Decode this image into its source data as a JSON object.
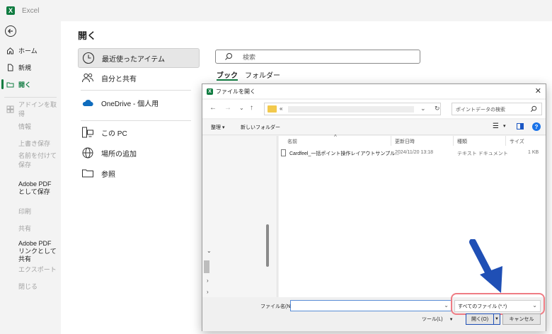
{
  "app": {
    "logo": "X",
    "title": "Excel"
  },
  "sidebar": {
    "items": [
      {
        "label": "ホーム",
        "icon": "home-icon"
      },
      {
        "label": "新規",
        "icon": "new-file-icon"
      },
      {
        "label": "開く",
        "icon": "open-folder-icon",
        "active": true
      },
      {
        "label": "アドインを取得",
        "icon": "grid-icon",
        "disabled": true
      },
      {
        "label": "情報",
        "disabled": true
      },
      {
        "label": "上書き保存",
        "disabled": true
      },
      {
        "label": "名前を付けて保存",
        "disabled": true
      },
      {
        "label": "Adobe PDF として保存"
      },
      {
        "label": "印刷",
        "disabled": true
      },
      {
        "label": "共有",
        "disabled": true
      },
      {
        "label": "Adobe PDF リンクとして共有"
      },
      {
        "label": "エクスポート",
        "disabled": true
      },
      {
        "label": "閉じる",
        "disabled": true
      }
    ]
  },
  "main": {
    "title": "開く",
    "locations": [
      {
        "label": "最近使ったアイテム",
        "icon": "clock-icon"
      },
      {
        "label": "自分と共有",
        "icon": "people-icon"
      },
      {
        "label": "OneDrive - 個人用",
        "icon": "cloud-icon"
      },
      {
        "label": "この PC",
        "icon": "pc-icon"
      },
      {
        "label": "場所の追加",
        "icon": "globe-icon"
      },
      {
        "label": "参照",
        "icon": "folder-icon"
      }
    ],
    "search_placeholder": "検索",
    "tabs": [
      "ブック",
      "フォルダー"
    ]
  },
  "dialog": {
    "title": "ファイルを開く",
    "breadcrumb": "«",
    "search_placeholder": "ポイントデータの検索",
    "toolbar": {
      "organize": "整理",
      "new_folder": "新しいフォルダー"
    },
    "columns": [
      "名前",
      "更新日時",
      "種類",
      "サイズ"
    ],
    "files": [
      {
        "name": "Cardfeel_一括ポイント操作レイアウトサンプル...",
        "modified": "2024/11/20 13:18",
        "type": "テキスト ドキュメント",
        "size": "1 KB"
      }
    ],
    "filename_label": "ファイル名(N):",
    "filename_value": "",
    "file_type_filter": "すべてのファイル (*.*)",
    "tools_label": "ツール(L)",
    "open_label": "開く(O)",
    "cancel_label": "キャンセル"
  },
  "colors": {
    "accent": "#107c41",
    "annotation_arrow": "#1f4fb5",
    "highlight_ring": "#ef7c84"
  }
}
